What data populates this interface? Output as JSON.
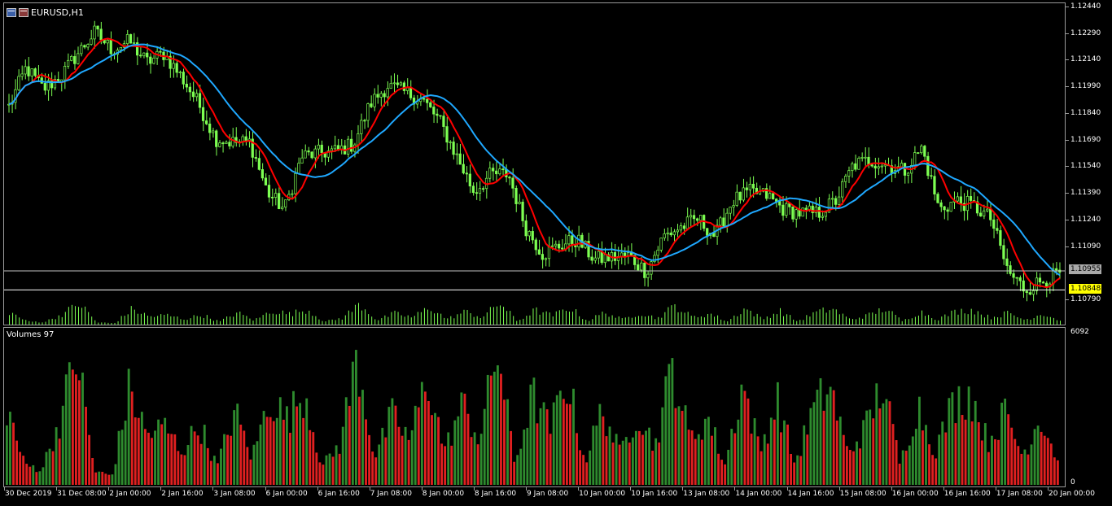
{
  "window": {
    "title": "EURUSD,H1",
    "icons": [
      "chart-window-icon",
      "symbol-icon"
    ]
  },
  "colors": {
    "background": "#000000",
    "bull_candle": "#7dff52",
    "bear_candle": "#7dff52",
    "ma_fast": "#ff0000",
    "ma_slow": "#1fa8ff",
    "volume_up": "#2e8b2e",
    "volume_down": "#e02020",
    "grid_border": "#9a9a9a",
    "ask_line": "#ffffff",
    "bid_line": "#c0c0c0",
    "ask_badge": "#ffff00",
    "bid_badge": "#a9a9a9"
  },
  "price_axis": {
    "labels": [
      "1.12440",
      "1.12290",
      "1.12140",
      "1.11990",
      "1.11840",
      "1.11690",
      "1.11540",
      "1.11390",
      "1.11240",
      "1.11090",
      "1.10790"
    ],
    "bid_value": "1.10955",
    "ask_value": "1.10848"
  },
  "volume_panel": {
    "title": "Volumes 97",
    "axis_max": "6092",
    "axis_min": "0"
  },
  "time_axis": {
    "labels": [
      "30 Dec 2019",
      "31 Dec 08:00",
      "2 Jan 00:00",
      "2 Jan 16:00",
      "3 Jan 08:00",
      "6 Jan 00:00",
      "6 Jan 16:00",
      "7 Jan 08:00",
      "8 Jan 00:00",
      "8 Jan 16:00",
      "9 Jan 08:00",
      "10 Jan 00:00",
      "10 Jan 16:00",
      "13 Jan 08:00",
      "14 Jan 00:00",
      "14 Jan 16:00",
      "15 Jan 08:00",
      "16 Jan 00:00",
      "16 Jan 16:00",
      "17 Jan 08:00",
      "20 Jan 00:00"
    ]
  },
  "chart_data": {
    "type": "candlestick",
    "symbol": "EURUSD",
    "timeframe": "H1",
    "ylim": [
      1.1079,
      1.1244
    ],
    "close_path": [
      1.1188,
      1.121,
      1.1198,
      1.1205,
      1.1218,
      1.123,
      1.122,
      1.1225,
      1.1213,
      1.1218,
      1.1205,
      1.119,
      1.117,
      1.1168,
      1.1168,
      1.114,
      1.113,
      1.116,
      1.1162,
      1.1163,
      1.1167,
      1.119,
      1.12,
      1.1196,
      1.1192,
      1.118,
      1.116,
      1.114,
      1.115,
      1.115,
      1.112,
      1.1105,
      1.111,
      1.1113,
      1.1102,
      1.1103,
      1.1104,
      1.1095,
      1.1115,
      1.112,
      1.1125,
      1.1115,
      1.1135,
      1.114,
      1.1138,
      1.113,
      1.1128,
      1.1128,
      1.1135,
      1.1155,
      1.1158,
      1.1155,
      1.1152,
      1.1165,
      1.113,
      1.1135,
      1.1132,
      1.1125,
      1.1095,
      1.1085,
      1.109,
      1.1094
    ],
    "volume_profile": [
      3500,
      900,
      700,
      2800,
      5900,
      600,
      400,
      4300,
      2200,
      2600,
      1500,
      2700,
      800,
      3300,
      1200,
      3900,
      2900,
      4200,
      800,
      1800,
      5700,
      1200,
      3100,
      2000,
      4800,
      1500,
      3600,
      2000,
      6100,
      900,
      4000,
      2500,
      4700,
      1000,
      3400,
      1400,
      3300,
      1700,
      5300,
      2000,
      3000,
      900,
      4500,
      1500,
      3800,
      900,
      3300,
      4400,
      1400,
      2500,
      4500,
      900,
      3600,
      1500,
      3600,
      4100,
      1900,
      3200,
      1300,
      3100,
      1100
    ]
  }
}
